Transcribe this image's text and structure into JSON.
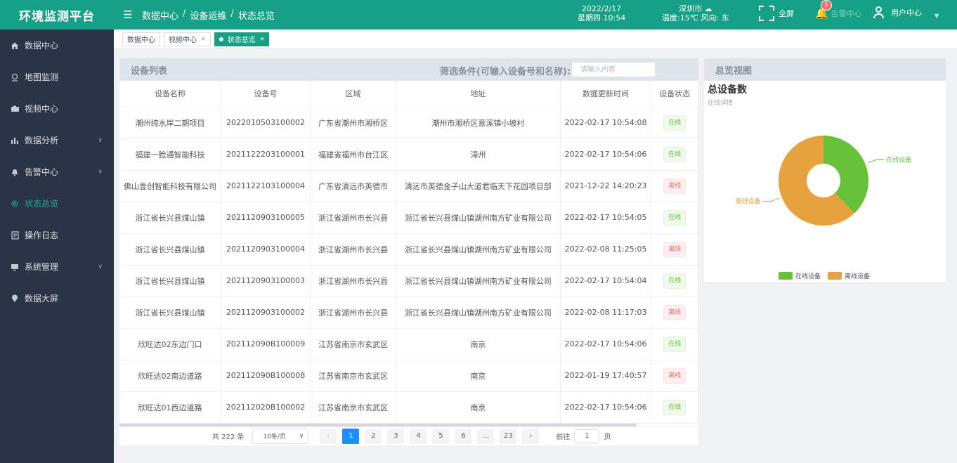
{
  "app": {
    "title": "环境监测平台"
  },
  "header": {
    "breadcrumb": [
      "数据中心",
      "设备运维",
      "状态总览"
    ],
    "date": "2022/2/17",
    "weekday_time": "星期四 10:54",
    "city": "深圳市",
    "weather": "温度:15℃ 风向: 东",
    "fullscreen_label": "全屏",
    "alarm_label": "告警中心",
    "alarm_count": "1",
    "user_label": "用户中心"
  },
  "sidebar": {
    "items": [
      {
        "label": "数据中心",
        "icon": "home-icon"
      },
      {
        "label": "地图监测",
        "icon": "map-pin-icon"
      },
      {
        "label": "视频中心",
        "icon": "camera-icon"
      },
      {
        "label": "数据分析",
        "icon": "bar-chart-icon",
        "expandable": true
      },
      {
        "label": "告警中心",
        "icon": "bell-icon",
        "expandable": true
      },
      {
        "label": "状态总览",
        "icon": "gear-icon",
        "active": true
      },
      {
        "label": "操作日志",
        "icon": "document-icon"
      },
      {
        "label": "系统管理",
        "icon": "monitor-icon",
        "expandable": true
      },
      {
        "label": "数据大屏",
        "icon": "location-icon"
      }
    ]
  },
  "tabs": [
    {
      "label": "数据中心",
      "closable": false,
      "active": false
    },
    {
      "label": "视频中心",
      "closable": true,
      "active": false
    },
    {
      "label": "状态总览",
      "closable": true,
      "active": true
    }
  ],
  "device_list": {
    "title": "设备列表",
    "filter_label": "筛选条件(可输入设备号和名称):",
    "filter_placeholder": "请输入内容",
    "columns": [
      "设备名称",
      "设备号",
      "区域",
      "地址",
      "数据更新时间",
      "设备状态"
    ],
    "rows": [
      {
        "name": "潮州纯水岸二期项目",
        "id": "2022010503100002",
        "region": "广东省潮州市湘桥区",
        "address": "潮州市湘桥区意溪镇小坡村",
        "time": "2022-02-17 10:54:08",
        "status": "在线",
        "online": true
      },
      {
        "name": "福建一脸通智能科技",
        "id": "2021122203100001",
        "region": "福建省福州市台江区",
        "address": "漳州",
        "time": "2022-02-17 10:54:06",
        "status": "在线",
        "online": true
      },
      {
        "name": "佛山壹创智能科技有限公司",
        "id": "2021122103100004",
        "region": "广东省清远市英德市",
        "address": "清远市英德金子山大道君临天下花园项目部",
        "time": "2021-12-22 14:20:23",
        "status": "离线",
        "online": false
      },
      {
        "name": "浙江省长兴县煤山镇",
        "id": "2021120903100005",
        "region": "浙江省湖州市长兴县",
        "address": "浙江省长兴县煤山镇湖州南方矿业有限公司",
        "time": "2022-02-17 10:54:05",
        "status": "在线",
        "online": true
      },
      {
        "name": "浙江省长兴县煤山镇",
        "id": "2021120903100004",
        "region": "浙江省湖州市长兴县",
        "address": "浙江省长兴县煤山镇湖州南方矿业有限公司",
        "time": "2022-02-08 11:25:05",
        "status": "离线",
        "online": false
      },
      {
        "name": "浙江省长兴县煤山镇",
        "id": "2021120903100003",
        "region": "浙江省湖州市长兴县",
        "address": "浙江省长兴县煤山镇湖州南方矿业有限公司",
        "time": "2022-02-17 10:54:04",
        "status": "在线",
        "online": true
      },
      {
        "name": "浙江省长兴县煤山镇",
        "id": "2021120903100002",
        "region": "浙江省湖州市长兴县",
        "address": "浙江省长兴县煤山镇湖州南方矿业有限公司",
        "time": "2022-02-08 11:17:03",
        "status": "离线",
        "online": false
      },
      {
        "name": "欣旺达02东边门口",
        "id": "202112090B100009",
        "region": "江苏省南京市玄武区",
        "address": "南京",
        "time": "2022-02-17 10:54:06",
        "status": "在线",
        "online": true
      },
      {
        "name": "欣旺达02南边道路",
        "id": "202112090B100008",
        "region": "江苏省南京市玄武区",
        "address": "南京",
        "time": "2022-01-19 17:40:57",
        "status": "离线",
        "online": false
      },
      {
        "name": "欣旺达01西边道路",
        "id": "202112020B100002",
        "region": "江苏省南京市玄武区",
        "address": "南京",
        "time": "2022-02-17 10:54:06",
        "status": "在线",
        "online": true
      }
    ]
  },
  "pagination": {
    "total": "共 222 条",
    "page_size": "10条/页",
    "pages": [
      "1",
      "2",
      "3",
      "4",
      "5",
      "6",
      "...",
      "23"
    ],
    "current": "1",
    "goto_prefix": "前往",
    "goto_value": "1",
    "goto_suffix": "页"
  },
  "overview": {
    "title": "总览视图",
    "chart_title": "总设备数",
    "chart_subtitle": "在线详情"
  },
  "chart_data": {
    "type": "pie",
    "donut": true,
    "title": "总设备数",
    "subtitle": "在线详情",
    "categories": [
      "在线设备",
      "离线设备"
    ],
    "values": [
      38,
      62
    ],
    "colors": [
      "#67c23a",
      "#e6a23c"
    ],
    "legend": "bottom"
  }
}
